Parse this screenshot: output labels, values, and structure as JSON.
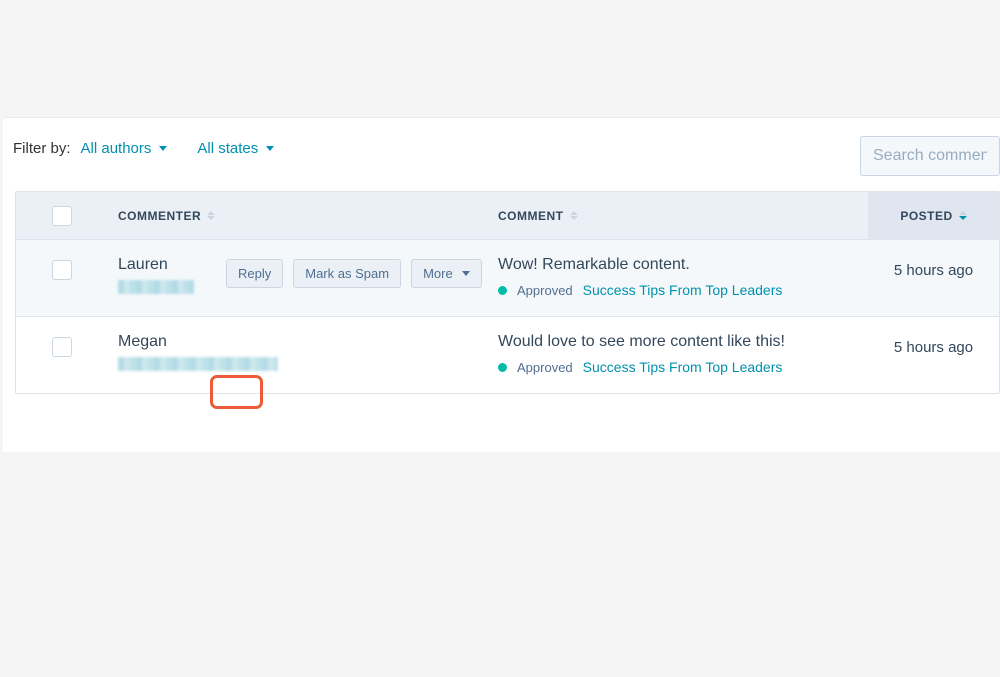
{
  "filters": {
    "label": "Filter by:",
    "authors": "All authors",
    "states": "All states"
  },
  "search": {
    "placeholder": "Search comments"
  },
  "columns": {
    "commenter": "COMMENTER",
    "comment": "COMMENT",
    "posted": "POSTED"
  },
  "actions": {
    "reply": "Reply",
    "spam": "Mark as Spam",
    "more": "More"
  },
  "rows": [
    {
      "name": "Lauren",
      "comment": "Wow! Remarkable content.",
      "status": "Approved",
      "post": "Success Tips From Top Leaders",
      "posted": "5 hours ago"
    },
    {
      "name": "Megan",
      "comment": "Would love to see more content like this!",
      "status": "Approved",
      "post": "Success Tips From Top Leaders",
      "posted": "5 hours ago"
    }
  ]
}
